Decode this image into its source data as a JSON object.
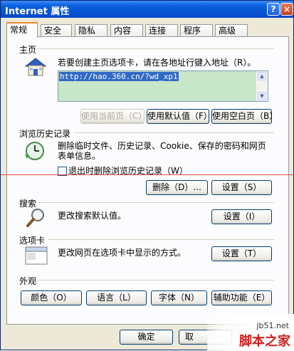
{
  "window": {
    "title": "Internet 属性",
    "help_label": "?",
    "close_label": "×"
  },
  "tabs": [
    {
      "label": "常规",
      "active": true
    },
    {
      "label": "安全"
    },
    {
      "label": "隐私"
    },
    {
      "label": "内容"
    },
    {
      "label": "连接"
    },
    {
      "label": "程序"
    },
    {
      "label": "高级"
    }
  ],
  "home": {
    "header": "主页",
    "description": "若要创建主页选项卡，请在各地址行键入地址（R）。",
    "address_value": "http://hao.360.cn/?wd_xp1",
    "use_current_label": "使用当前页（C）",
    "use_default_label": "使用默认值（F）",
    "use_blank_label": "使用空白页（B）"
  },
  "history": {
    "header": "浏览历史记录",
    "description_line1": "删除临时文件、历史记录、Cookie、保存的密码和网页",
    "description_line2": "表单信息。",
    "delete_on_exit_label": "退出时删除浏览历史记录（W）",
    "delete_on_exit_checked": false,
    "delete_label": "删除（D）...",
    "settings_label": "设置（S）"
  },
  "search": {
    "header": "搜索",
    "description": "更改搜索默认值。",
    "settings_label": "设置（I）"
  },
  "tabs_section": {
    "header": "选项卡",
    "description": "更改网页在选项卡中显示的方式。",
    "settings_label": "设置（T）"
  },
  "appearance": {
    "header": "外观",
    "colors_label": "颜色（O）",
    "languages_label": "语言（L）",
    "fonts_label": "字体（N）",
    "accessibility_label": "辅助功能（E）"
  },
  "footer": {
    "ok_label": "确定",
    "cancel_partial": "取"
  },
  "watermark": {
    "line1": "jb51.net",
    "line2": "脚本之家"
  },
  "colors": {
    "titlebar": "#0548c7",
    "dialog_bg": "#ece9d8",
    "address_bg": "#c8e6c8",
    "selection": "#316ac5",
    "active_tab_accent": "#e68b2c",
    "annotation_line": "#e84848"
  }
}
